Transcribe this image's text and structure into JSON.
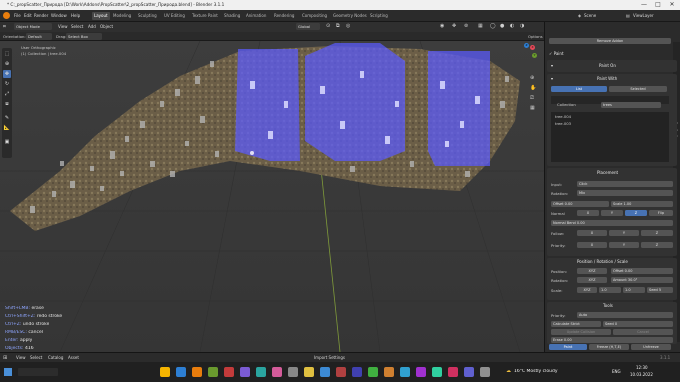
{
  "window": {
    "title": "* C:_propScatter_Природа [D:\\Work\\Addons\\PropScatter\\2_propScatter_Природа.blend] - Blender 3.1.1",
    "minimize": "—",
    "maximize": "□",
    "close": "✕"
  },
  "menubar": {
    "items": [
      "File",
      "Edit",
      "Render",
      "Window",
      "Help"
    ],
    "workspaces": [
      "Layout",
      "Modeling",
      "Sculpting",
      "UV Editing",
      "Texture Paint",
      "Shading",
      "Animation",
      "Rendering",
      "Compositing",
      "Geometry Nodes",
      "Scripting"
    ],
    "active_workspace": "Layout",
    "scene_label": "Scene",
    "viewlayer_label": "ViewLayer"
  },
  "viewport_header": {
    "mode": "Object Mode",
    "menus": [
      "View",
      "Select",
      "Add",
      "Object"
    ],
    "orientation_label": "Orientation:",
    "orientation_value": "Default",
    "drag_label": "Drag:",
    "drag_value": "Select Box",
    "global": "Global",
    "options": "Options"
  },
  "viewport": {
    "view_name": "User Orthographic",
    "collection": "(1) Collection | tree.004",
    "gizmo_x": "X",
    "gizmo_y": "Y",
    "gizmo_z": "Z"
  },
  "hints": [
    {
      "key": "Shift+LMB:",
      "action": "erase"
    },
    {
      "key": "Ctrl+Shift+Z:",
      "action": "redo stroke"
    },
    {
      "key": "Ctrl+Z:",
      "action": "undo stroke"
    },
    {
      "key": "RMB/ESC:",
      "action": "cancel"
    },
    {
      "key": "Enter:",
      "action": "apply"
    },
    {
      "key": "Objects:",
      "action": "416"
    }
  ],
  "sidebar": {
    "remove_button": "Remove Addon",
    "paint_label": "Paint",
    "paint_on_title": "Paint On",
    "paint_with_title": "Paint With",
    "list_tab": "List",
    "selected_tab": "Selected",
    "collection_label": "Collection",
    "collection_value": "trees",
    "objects": [
      "tree.004",
      "tree.003"
    ],
    "placement_title": "Placement",
    "input_label": "Input:",
    "input_value": "Click",
    "rotation_label": "Rotation:",
    "rotation_value": "Mix",
    "offset_label": "Offset",
    "offset_value": "0.00",
    "scale_label": "Scale",
    "scale_value": "1.00",
    "normal_label": "Normal",
    "normal_axes": [
      "X",
      "Y",
      "Z",
      "Flip"
    ],
    "normal_bend": "Normal Bend",
    "normal_bend_value": "0.00",
    "follow_label": "Follow:",
    "follow_axes": [
      "X",
      "Y",
      "Z"
    ],
    "priority_label": "Priority:",
    "priority_axes": [
      "X",
      "Y",
      "Z"
    ],
    "prs_title": "Position / Rotation / Scale",
    "position_label": "Position:",
    "position_offset": "Offset",
    "position_offset_value": "0.00",
    "rotation_row_label": "Rotation:",
    "rotation_amount": "Amount",
    "rotation_amount_value": "30.0°",
    "scale_row_label": "Scale:",
    "scale_min": "1.0",
    "scale_max": "1.0",
    "seed_label": "Seed",
    "seed_value": "5",
    "tools_title": "Tools",
    "priority_select_label": "Priority:",
    "priority_select_value": "Auto",
    "calculate_label": "Calculate",
    "calculate_value": "Strict",
    "seed2_label": "Seed",
    "seed2_value": "0",
    "update_collision": "Update Collision",
    "cancel": "Cancel",
    "erase_label": "Erase",
    "erase_value": "0.00",
    "paint_button": "Paint",
    "freeze_button": "Freeze (H,T,E)",
    "unfreeze_button": "Unfreeze"
  },
  "bottombar": {
    "menus": [
      "View",
      "Select",
      "Catalog",
      "Asset"
    ],
    "import_settings": "Import Settings",
    "version": "3.1.1"
  },
  "taskbar": {
    "weather": "16°C  Mostly cloudy",
    "time": "12:30",
    "date": "10.03.2022",
    "lang": "ENG"
  },
  "colors": {
    "accent": "#4772b3",
    "paint_overlay": "#5b5bff",
    "terrain": "#6b5e46"
  }
}
